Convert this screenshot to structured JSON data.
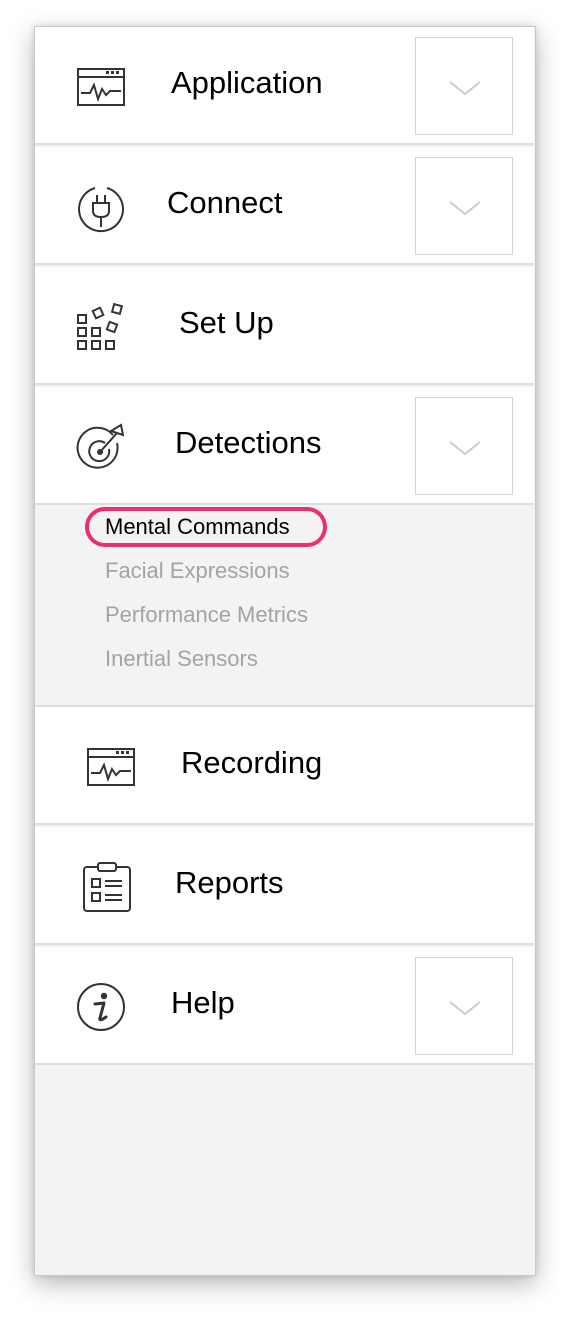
{
  "menu": {
    "application": {
      "label": "Application",
      "icon": "monitor-waveform-icon"
    },
    "connect": {
      "label": "Connect",
      "icon": "plug-icon"
    },
    "setup": {
      "label": "Set Up",
      "icon": "grid-blocks-icon"
    },
    "detections": {
      "label": "Detections",
      "icon": "target-icon"
    },
    "recording": {
      "label": "Recording",
      "icon": "monitor-waveform-icon"
    },
    "reports": {
      "label": "Reports",
      "icon": "clipboard-icon"
    },
    "help": {
      "label": "Help",
      "icon": "info-icon"
    }
  },
  "detections_submenu": [
    {
      "label": "Mental Commands",
      "active": true
    },
    {
      "label": "Facial Expressions",
      "active": false
    },
    {
      "label": "Performance Metrics",
      "active": false
    },
    {
      "label": "Inertial Sensors",
      "active": false
    }
  ],
  "colors": {
    "highlight": "#ee2d6b",
    "inactive_text": "#a3a3a3",
    "panel_bg": "#f3f3f3"
  }
}
